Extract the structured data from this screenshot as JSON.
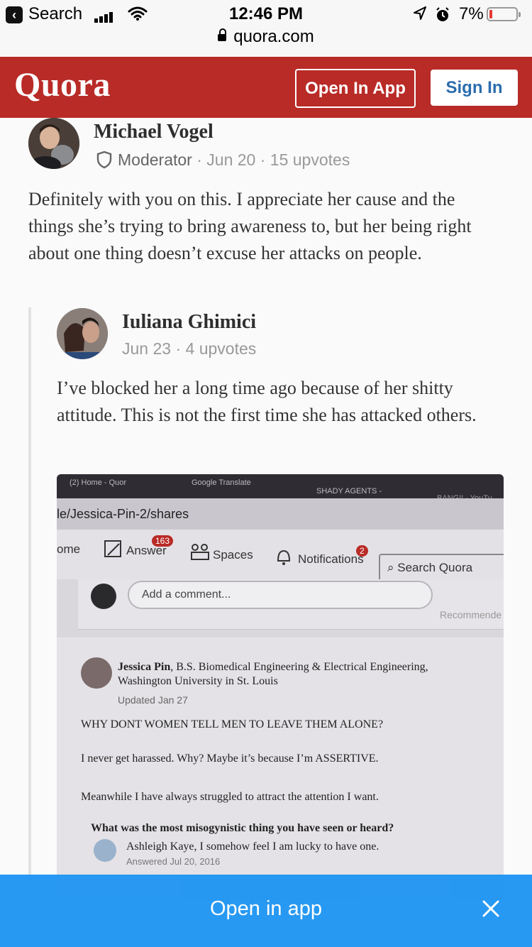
{
  "status_bar": {
    "back_label": "Search",
    "time": "12:46 PM",
    "battery_percent": "7%",
    "url": "quora.com"
  },
  "header": {
    "logo": "Quora",
    "open_in_app": "Open In App",
    "sign_in": "Sign In",
    "brand_color": "#b92b27"
  },
  "comment": {
    "author": "Michael Vogel",
    "role": "Moderator",
    "date": "Jun 20",
    "upvotes": "15 upvotes",
    "text": "Definitely with you on this. I appreciate her cause and the things she’s trying to bring awareness to, but her being right about one thing doesn’t excuse her attacks on people."
  },
  "reply": {
    "author": "Iuliana Ghimici",
    "date": "Jun 23",
    "upvotes": "4 upvotes",
    "text": "I’ve blocked her a long time ago because of her shitty attitude. This is not the first time she has attacked others."
  },
  "photo": {
    "tabs": [
      "(2) Home - Quor",
      "Google Translate",
      "SHADY AGENTS -",
      "BANG!! - YouTu"
    ],
    "url_text": "le/Jessica-Pin-2/shares",
    "nav": {
      "home": "ome",
      "answer": "Answer",
      "answer_badge": "163",
      "spaces": "Spaces",
      "notifications": "Notifications",
      "notifications_badge": "2",
      "search": "Search Quora"
    },
    "comment_placeholder": "Add a comment...",
    "recommended": "Recommende",
    "answer_author": "Jessica Pin",
    "answer_credential": ", B.S. Biomedical Engineering & Electrical Engineering,",
    "answer_credential_2": "Washington University in St. Louis",
    "answer_updated": "Updated Jan 27",
    "line1": "WHY DONT WOMEN TELL MEN TO LEAVE THEM ALONE?",
    "line2": "I never get harassed. Why? Maybe it’s because I’m ASSERTIVE.",
    "line3": "Meanwhile I have always struggled to attract the attention I want.",
    "question": "What was the most misogynistic thing you have seen or heard?",
    "question_author": "Ashleigh Kaye",
    "question_author_text": ", I somehow feel I am lucky to have one.",
    "question_answered": "Answered Jul 20, 2016"
  },
  "banner": {
    "label": "Open in app",
    "color": "#2196f3"
  }
}
